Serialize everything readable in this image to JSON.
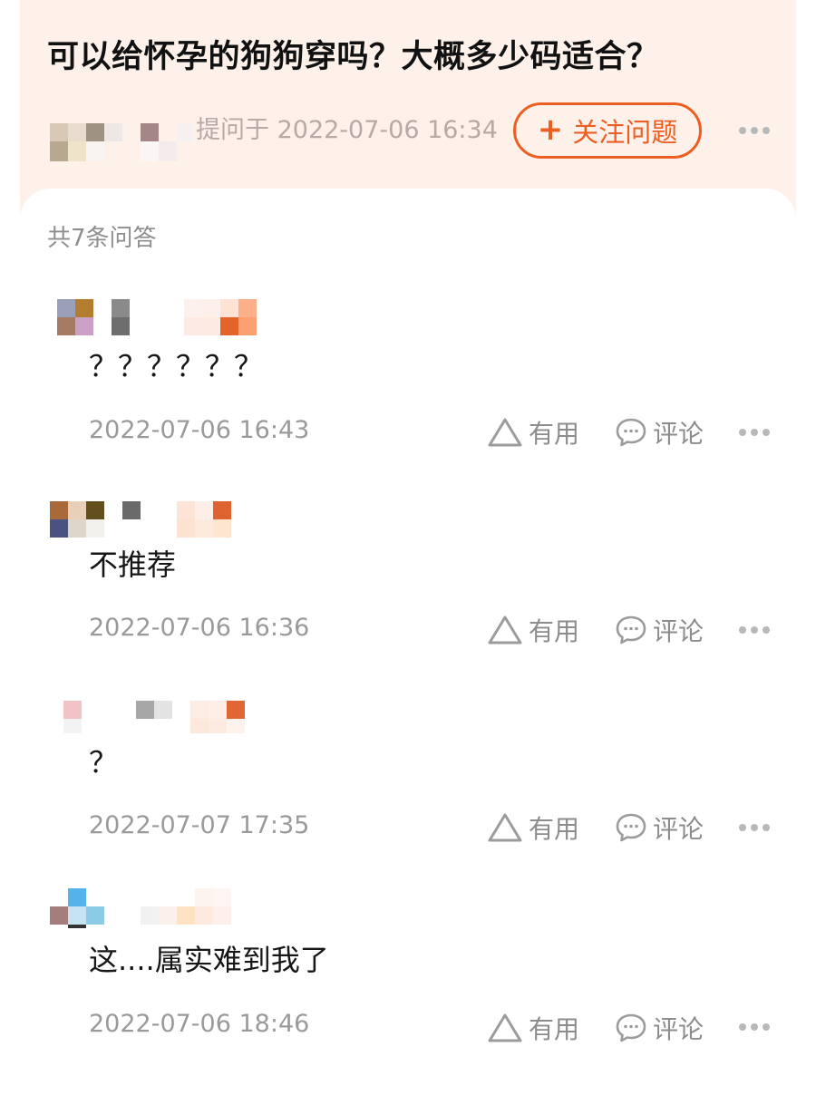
{
  "question": {
    "title": "可以给怀孕的狗狗穿吗？大概多少码适合？",
    "asked_at": "提问于 2022-07-06 16:34",
    "follow_label": "关注问题"
  },
  "answers_count": "共7条问答",
  "answers": [
    {
      "text": "？？？？？？",
      "time": "2022-07-06 16:43",
      "useful": "有用",
      "comment": "评论"
    },
    {
      "text": "不推荐",
      "time": "2022-07-06 16:36",
      "useful": "有用",
      "comment": "评论"
    },
    {
      "text": "？",
      "time": "2022-07-07 17:35",
      "useful": "有用",
      "comment": "评论"
    },
    {
      "text": "这....属实难到我了",
      "time": "2022-07-06 18:46",
      "useful": "有用",
      "comment": "评论"
    }
  ],
  "colors": {
    "accent": "#ec5e21",
    "header_bg": "#fdf1ea"
  },
  "icons": {
    "useful": "triangle-outline-icon",
    "comment": "speech-bubble-icon",
    "more": "ellipsis-icon"
  }
}
